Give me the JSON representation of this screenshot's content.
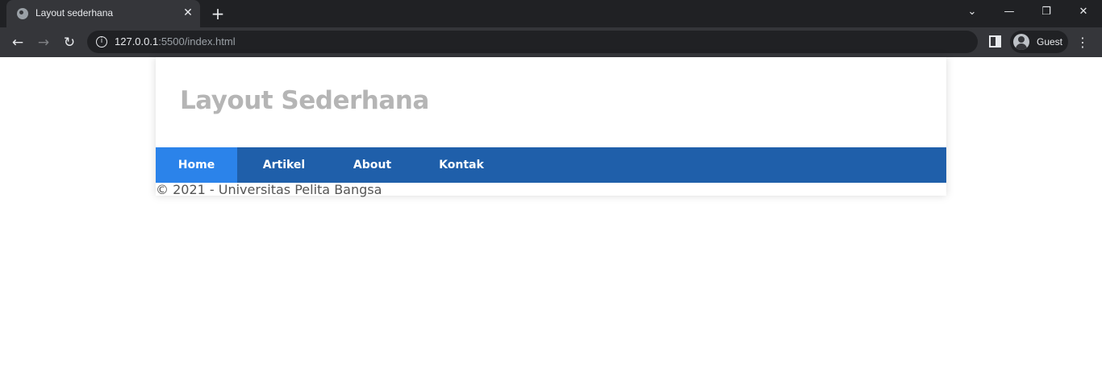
{
  "browser": {
    "tab_title": "Layout sederhana",
    "tab_close": "✕",
    "new_tab": "+",
    "window_minimize": "—",
    "window_restore": "❐",
    "window_close": "✕",
    "window_caret": "⌄",
    "back": "←",
    "forward": "→",
    "reload": "↻",
    "info": "i",
    "url_host": "127.0.0.1",
    "url_rest": ":5500/index.html",
    "profile_name": "Guest",
    "menu": "⋮",
    "icons": [
      "globe-icon",
      "close-icon",
      "plus-icon",
      "chevron-down-icon",
      "minimize-icon",
      "restore-icon",
      "back-arrow-icon",
      "forward-arrow-icon",
      "reload-icon",
      "info-icon",
      "side-panel-icon",
      "avatar-icon",
      "kebab-menu-icon"
    ]
  },
  "site": {
    "title": "Layout Sederhana",
    "nav": [
      {
        "label": "Home",
        "active": true
      },
      {
        "label": "Artikel",
        "active": false
      },
      {
        "label": "About",
        "active": false
      },
      {
        "label": "Kontak",
        "active": false
      }
    ],
    "footer": "© 2021 - Universitas Pelita Bangsa"
  },
  "colors": {
    "nav_bar": "#1f5faa",
    "nav_active": "#2b83ea",
    "title_text": "#b5b5b5",
    "chrome_dark": "#202124",
    "chrome_toolbar": "#35363a"
  }
}
